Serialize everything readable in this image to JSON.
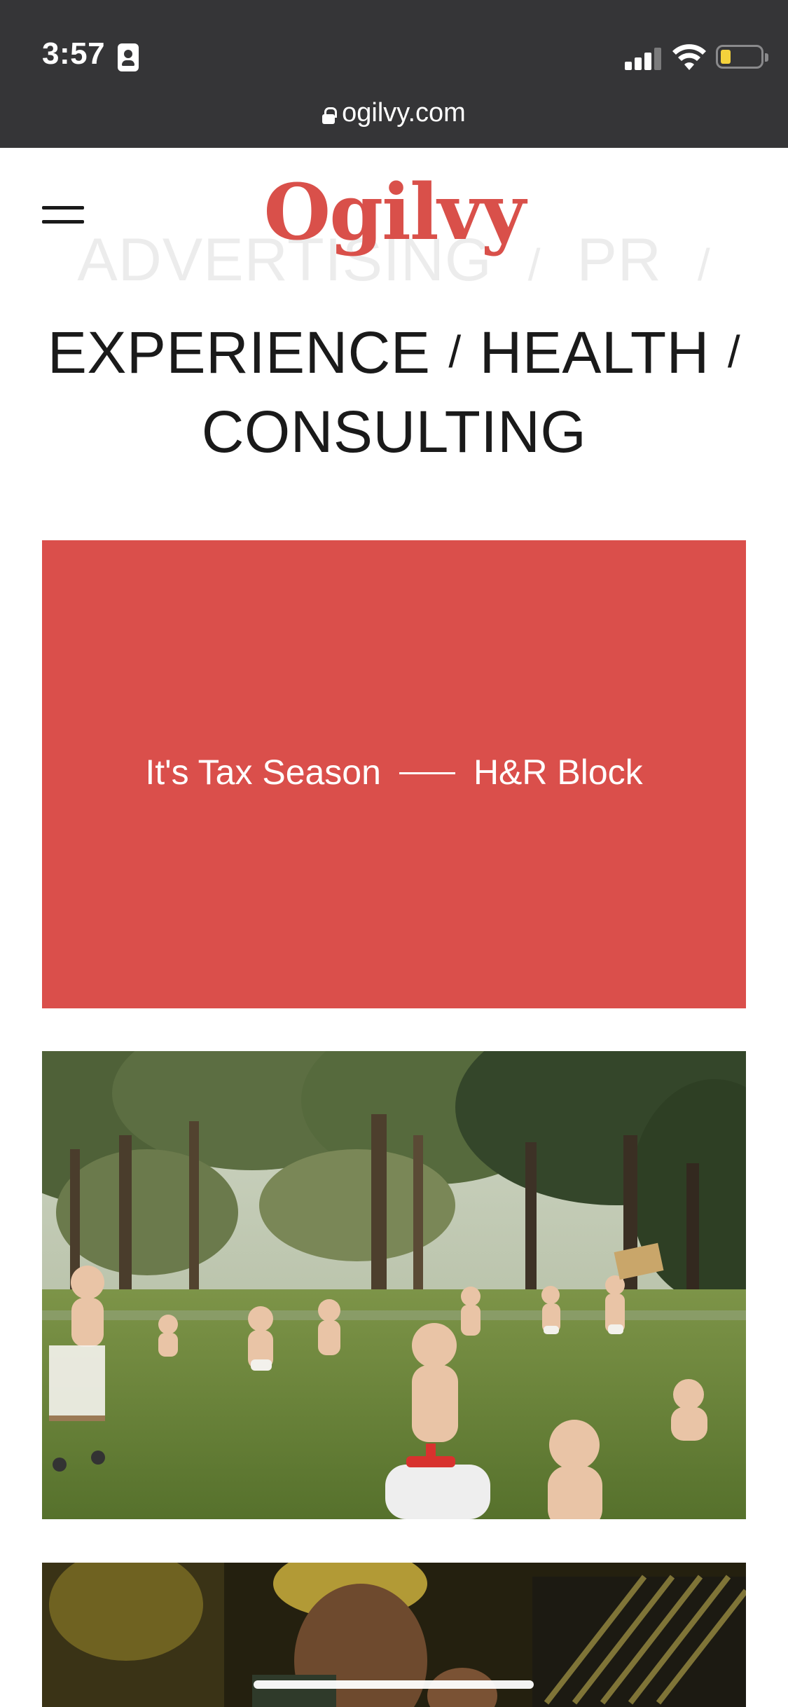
{
  "status_bar": {
    "time": "3:57"
  },
  "browser": {
    "url": "ogilvy.com"
  },
  "header": {
    "logo": "Ogilvy"
  },
  "disciplines": {
    "faded_line": [
      "ADVERTISING",
      "PR"
    ],
    "line1": [
      "EXPERIENCE",
      "HEALTH"
    ],
    "line2": "CONSULTING",
    "separator": "/"
  },
  "featured": {
    "title": "It's Tax Season",
    "client": "H&R Block"
  },
  "colors": {
    "brand_red": "#da4f4b",
    "status_bar_bg": "#353537"
  }
}
